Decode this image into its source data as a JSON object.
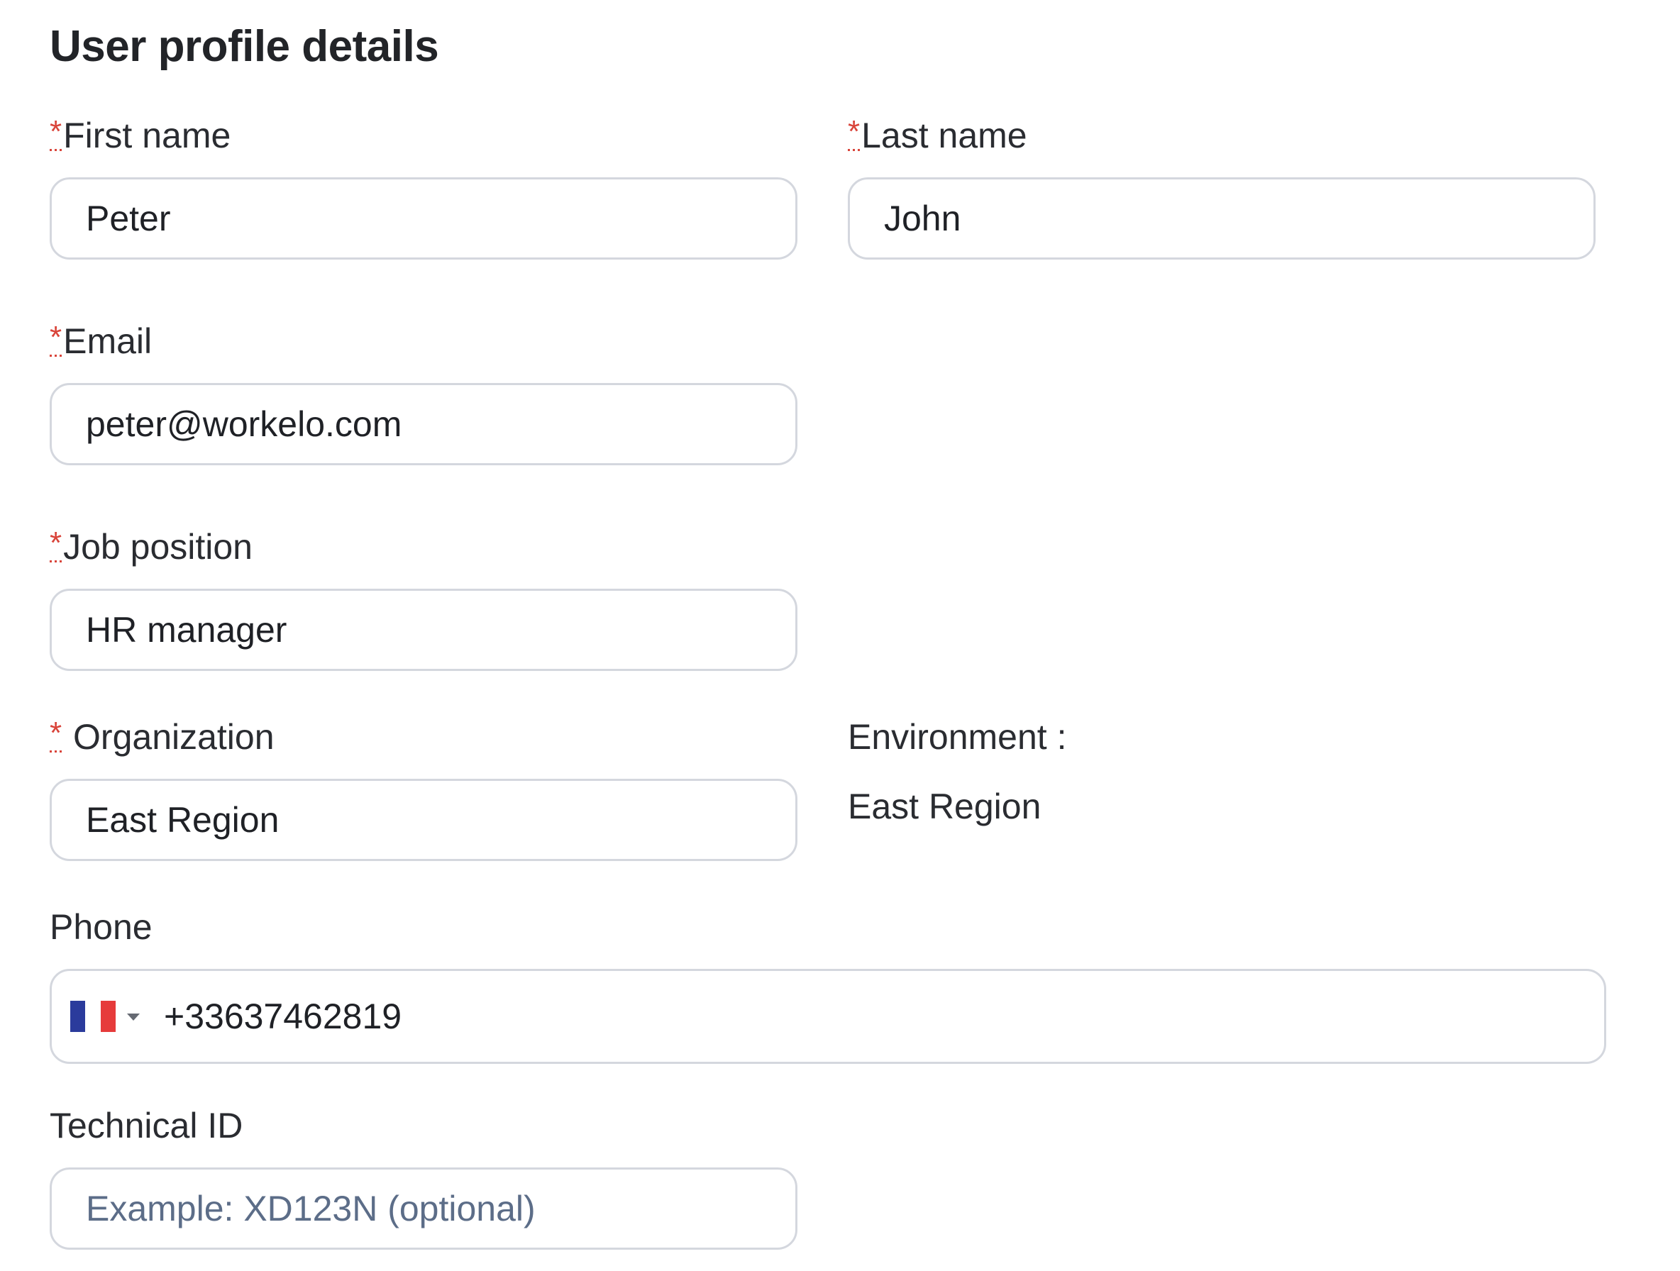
{
  "form": {
    "title": "User profile details",
    "required_marker": "*",
    "first_name": {
      "label": "First name",
      "value": "Peter"
    },
    "last_name": {
      "label": "Last name",
      "value": "John"
    },
    "email": {
      "label": "Email",
      "value": "peter@workelo.com"
    },
    "job_position": {
      "label": "Job position",
      "value": "HR manager"
    },
    "organization": {
      "label": "Organization",
      "value": "East Region"
    },
    "environment": {
      "label": "Environment :",
      "value": "East Region"
    },
    "phone": {
      "label": "Phone",
      "value": "+33637462819",
      "country_flag_icon": "france-flag-icon",
      "flag_colors": [
        "#2b3b9c",
        "#ffffff",
        "#e63b3b"
      ]
    },
    "technical_id": {
      "label": "Technical ID",
      "placeholder": "Example: XD123N (optional)"
    }
  },
  "colors": {
    "required": "#d9443a",
    "border": "#d4d7de",
    "placeholder": "#5c6d88"
  }
}
